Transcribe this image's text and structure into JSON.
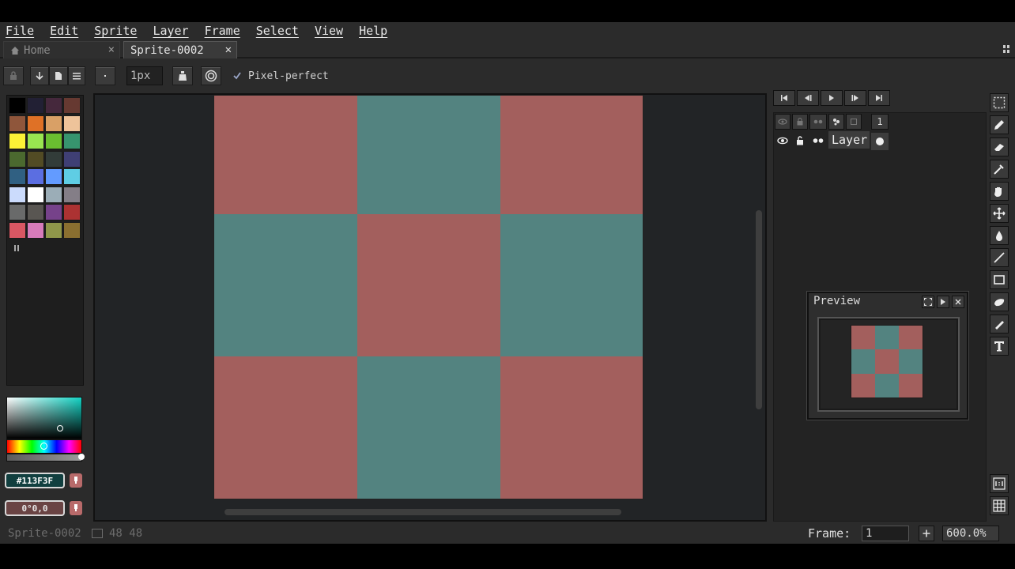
{
  "menubar": {
    "items": [
      {
        "label": "File"
      },
      {
        "label": "Edit"
      },
      {
        "label": "Sprite"
      },
      {
        "label": "Layer"
      },
      {
        "label": "Frame"
      },
      {
        "label": "Select"
      },
      {
        "label": "View"
      },
      {
        "label": "Help"
      }
    ]
  },
  "tabs": {
    "home": {
      "label": "Home",
      "close": "×",
      "icon": "home-icon"
    },
    "active": {
      "label": "Sprite-0002",
      "close": "✕"
    }
  },
  "options": {
    "brush_size": "1px",
    "pixel_perfect_label": "Pixel-perfect",
    "pixel_perfect_checked": true
  },
  "palette": {
    "colors": [
      "#000000",
      "#222034",
      "#45283c",
      "#663931",
      "#8f563b",
      "#df7126",
      "#d9a066",
      "#eec39a",
      "#fbf236",
      "#99e550",
      "#6abe30",
      "#37946e",
      "#4b692f",
      "#524b24",
      "#323c39",
      "#3f3f74",
      "#306082",
      "#5b6ee1",
      "#639bff",
      "#5fcde4",
      "#cbdbfc",
      "#ffffff",
      "#9badb7",
      "#847e87",
      "#696a6a",
      "#595652",
      "#76428a",
      "#ac3232",
      "#d95763",
      "#d77bba",
      "#8f974a",
      "#8a6f30"
    ]
  },
  "color_picker": {
    "foreground_hex": "#113F3F",
    "background_value": "0°0,0",
    "foreground_color": "#113f3f"
  },
  "canvas": {
    "pattern": [
      "r",
      "t",
      "r",
      "t",
      "r",
      "t",
      "r",
      "t",
      "r"
    ],
    "red": "#a35f5d",
    "teal": "#538380"
  },
  "timeline": {
    "frame_number": "1",
    "layer_name": "Layer"
  },
  "preview": {
    "title": "Preview"
  },
  "status": {
    "sprite_name": "Sprite-0002",
    "size": "48 48",
    "frame_label": "Frame:",
    "frame_value": "1",
    "zoom": "600.0%"
  }
}
